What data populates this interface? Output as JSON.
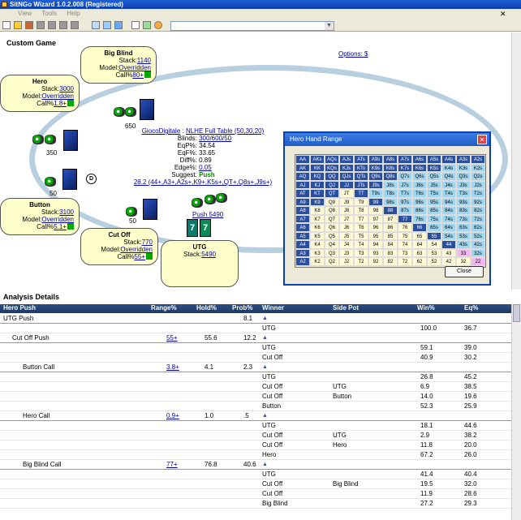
{
  "window": {
    "title": "SitNGo Wizard 1.0.2.008 (Registered)"
  },
  "menu": {
    "items": [
      "View",
      "Tools",
      "Help"
    ]
  },
  "custom_game": {
    "heading": "Custom Game",
    "options_link": "Options: $"
  },
  "players": {
    "big_blind": {
      "name": "Big Blind",
      "stack_label": "Stack:",
      "stack": "1140",
      "model_label": "Model:",
      "model": "Overridden",
      "call_label": "Call%",
      "call": "80+"
    },
    "hero": {
      "name": "Hero",
      "stack_label": "Stack:",
      "stack": "3000",
      "model_label": "Model:",
      "model": "Overridden",
      "call_label": "Call%",
      "call": "1.8+"
    },
    "button": {
      "name": "Button",
      "stack_label": "Stack:",
      "stack": "3100",
      "model_label": "Model:",
      "model": "Overridden",
      "call_label": "Call%",
      "call": "5.1+"
    },
    "cut_off": {
      "name": "Cut Off",
      "stack_label": "Stack:",
      "stack": "770",
      "model_label": "Model:",
      "model": "Overridden",
      "call_label": "Call%",
      "call": "55+"
    },
    "utg": {
      "name": "UTG",
      "stack_label": "Stack:",
      "stack": "5490"
    }
  },
  "bets": {
    "bb_chips": "650",
    "hero_chips": "350",
    "button_chips": "50",
    "cut_off_chips": "50",
    "utg_push": "Push 5490"
  },
  "dealer": "D",
  "hero_cards": [
    "7",
    "7"
  ],
  "info": {
    "site": "GiocoDigitale",
    "table": "NLHE Full Table (50,30,20)",
    "rows": [
      {
        "k": "Blinds:",
        "v": "300/600/50",
        "link": true
      },
      {
        "k": "EqP%:",
        "v": "34.54",
        "link": false
      },
      {
        "k": "EqF%:",
        "v": "33.65",
        "link": false
      },
      {
        "k": "Diff%:",
        "v": "0.89",
        "link": false
      },
      {
        "k": "Edge%:",
        "v": "0.05",
        "link": true
      }
    ],
    "suggest_label": "Suggest:",
    "suggest_value": "Push",
    "range": "28.2 (44+,A3+,A2s+,K9+,K5s+,QT+,Q8s+,J9s+)"
  },
  "dialog": {
    "title": "Hero Hand Range",
    "close_label": "Close",
    "grid": [
      [
        "AA",
        "AKs",
        "AQs",
        "AJs",
        "ATs",
        "A9s",
        "A8s",
        "A7s",
        "A6s",
        "A5s",
        "A4s",
        "A3s",
        "A2s"
      ],
      [
        "AK",
        "KK",
        "KQs",
        "KJs",
        "KTs",
        "K9s",
        "K8s",
        "K7s",
        "K6s",
        "K5s",
        "K4s",
        "K3s",
        "K2s"
      ],
      [
        "AQ",
        "KQ",
        "QQ",
        "QJs",
        "QTs",
        "Q9s",
        "Q8s",
        "Q7s",
        "Q6s",
        "Q5s",
        "Q4s",
        "Q3s",
        "Q2s"
      ],
      [
        "AJ",
        "KJ",
        "QJ",
        "JJ",
        "JTs",
        "J9s",
        "J8s",
        "J7s",
        "J6s",
        "J5s",
        "J4s",
        "J3s",
        "J2s"
      ],
      [
        "AT",
        "KT",
        "QT",
        "JT",
        "TT",
        "T9s",
        "T8s",
        "T7s",
        "T6s",
        "T5s",
        "T4s",
        "T3s",
        "T2s"
      ],
      [
        "A9",
        "K9",
        "Q9",
        "J9",
        "T9",
        "99",
        "98s",
        "97s",
        "96s",
        "95s",
        "94s",
        "93s",
        "92s"
      ],
      [
        "A8",
        "K8",
        "Q8",
        "J8",
        "T8",
        "98",
        "88",
        "87s",
        "86s",
        "85s",
        "84s",
        "83s",
        "82s"
      ],
      [
        "A7",
        "K7",
        "Q7",
        "J7",
        "T7",
        "97",
        "87",
        "77",
        "76s",
        "75s",
        "74s",
        "73s",
        "72s"
      ],
      [
        "A6",
        "K6",
        "Q6",
        "J6",
        "T6",
        "96",
        "86",
        "76",
        "66",
        "65s",
        "64s",
        "63s",
        "62s"
      ],
      [
        "A5",
        "K5",
        "Q5",
        "J5",
        "T5",
        "95",
        "85",
        "75",
        "65",
        "55",
        "54s",
        "53s",
        "52s"
      ],
      [
        "A4",
        "K4",
        "Q4",
        "J4",
        "T4",
        "94",
        "84",
        "74",
        "64",
        "54",
        "44",
        "43s",
        "42s"
      ],
      [
        "A3",
        "K3",
        "Q3",
        "J3",
        "T3",
        "93",
        "83",
        "73",
        "63",
        "53",
        "43",
        "33",
        "32s"
      ],
      [
        "A2",
        "K2",
        "Q2",
        "J2",
        "T2",
        "92",
        "82",
        "72",
        "62",
        "52",
        "42",
        "32",
        "22"
      ]
    ],
    "classes": [
      [
        "s",
        "s",
        "s",
        "s",
        "s",
        "s",
        "s",
        "s",
        "s",
        "s",
        "s",
        "s",
        "s"
      ],
      [
        "s",
        "s",
        "s",
        "s",
        "s",
        "s",
        "s",
        "s",
        "s",
        "s",
        "l",
        "l",
        "l"
      ],
      [
        "s",
        "s",
        "s",
        "s",
        "s",
        "s",
        "s",
        "l",
        "l",
        "l",
        "l",
        "l",
        "l"
      ],
      [
        "s",
        "s",
        "s",
        "s",
        "s",
        "s",
        "l",
        "l",
        "l",
        "l",
        "l",
        "l",
        "l"
      ],
      [
        "s",
        "s",
        "s",
        "n",
        "s",
        "l",
        "l",
        "l",
        "l",
        "l",
        "l",
        "l",
        "l"
      ],
      [
        "s",
        "s",
        "n",
        "n",
        "n",
        "s",
        "l",
        "l",
        "l",
        "l",
        "l",
        "l",
        "l"
      ],
      [
        "s",
        "n",
        "n",
        "n",
        "n",
        "n",
        "s",
        "l",
        "l",
        "l",
        "l",
        "l",
        "l"
      ],
      [
        "s",
        "n",
        "n",
        "n",
        "n",
        "n",
        "n",
        "s",
        "l",
        "l",
        "l",
        "l",
        "l"
      ],
      [
        "s",
        "n",
        "n",
        "n",
        "n",
        "n",
        "n",
        "n",
        "s",
        "l",
        "l",
        "l",
        "l"
      ],
      [
        "s",
        "n",
        "n",
        "n",
        "n",
        "n",
        "n",
        "n",
        "n",
        "s",
        "l",
        "l",
        "l"
      ],
      [
        "s",
        "n",
        "n",
        "n",
        "n",
        "n",
        "n",
        "n",
        "n",
        "n",
        "s",
        "l",
        "l"
      ],
      [
        "s",
        "n",
        "n",
        "n",
        "n",
        "n",
        "n",
        "n",
        "n",
        "n",
        "n",
        "p",
        "l"
      ],
      [
        "s",
        "n",
        "n",
        "n",
        "n",
        "n",
        "n",
        "n",
        "n",
        "n",
        "n",
        "n",
        "p"
      ]
    ]
  },
  "analysis": {
    "heading": "Analysis Details",
    "columns": {
      "hero_push": "Hero Push",
      "range": "Range%",
      "hold": "Hold%",
      "prob": "Prob%",
      "winner": "Winner",
      "side_pot": "Side Pot",
      "win": "Win%",
      "eq": "Eq%"
    },
    "rows": [
      {
        "name": "UTG Push",
        "indent": 0,
        "range": "",
        "hold": "",
        "prob": "8.1",
        "winner": "",
        "side": "",
        "win": "",
        "eq": "",
        "tri": true,
        "top": true
      },
      {
        "name": "",
        "indent": 0,
        "range": "",
        "hold": "",
        "prob": "",
        "winner": "UTG",
        "side": "",
        "win": "100.0",
        "eq": "36.7",
        "tri": false,
        "top": false
      },
      {
        "name": "Cut Off Push",
        "indent": 1,
        "range": "55+",
        "hold": "55.6",
        "prob": "12.2",
        "winner": "",
        "side": "",
        "win": "",
        "eq": "",
        "tri": true,
        "top": true
      },
      {
        "name": "",
        "indent": 0,
        "range": "",
        "hold": "",
        "prob": "",
        "winner": "UTG",
        "side": "",
        "win": "59.1",
        "eq": "39.0",
        "tri": false,
        "top": false
      },
      {
        "name": "",
        "indent": 0,
        "range": "",
        "hold": "",
        "prob": "",
        "winner": "Cut Off",
        "side": "",
        "win": "40.9",
        "eq": "30.2",
        "tri": false,
        "top": false
      },
      {
        "name": "Button Call",
        "indent": 2,
        "range": "3.8+",
        "hold": "4.1",
        "prob": "2.3",
        "winner": "",
        "side": "",
        "win": "",
        "eq": "",
        "tri": true,
        "top": true
      },
      {
        "name": "",
        "indent": 0,
        "range": "",
        "hold": "",
        "prob": "",
        "winner": "UTG",
        "side": "",
        "win": "26.8",
        "eq": "45.2",
        "tri": false,
        "top": false
      },
      {
        "name": "",
        "indent": 0,
        "range": "",
        "hold": "",
        "prob": "",
        "winner": "Cut Off",
        "side": "UTG",
        "win": "6.9",
        "eq": "38.5",
        "tri": false,
        "top": false
      },
      {
        "name": "",
        "indent": 0,
        "range": "",
        "hold": "",
        "prob": "",
        "winner": "Cut Off",
        "side": "Button",
        "win": "14.0",
        "eq": "19.6",
        "tri": false,
        "top": false
      },
      {
        "name": "",
        "indent": 0,
        "range": "",
        "hold": "",
        "prob": "",
        "winner": "Button",
        "side": "",
        "win": "52.3",
        "eq": "25.9",
        "tri": false,
        "top": false
      },
      {
        "name": "Hero Call",
        "indent": 2,
        "range": "0.9+",
        "hold": "1.0",
        "prob": ".5",
        "winner": "",
        "side": "",
        "win": "",
        "eq": "",
        "tri": true,
        "top": true
      },
      {
        "name": "",
        "indent": 0,
        "range": "",
        "hold": "",
        "prob": "",
        "winner": "UTG",
        "side": "",
        "win": "18.1",
        "eq": "44.6",
        "tri": false,
        "top": false
      },
      {
        "name": "",
        "indent": 0,
        "range": "",
        "hold": "",
        "prob": "",
        "winner": "Cut Off",
        "side": "UTG",
        "win": "2.9",
        "eq": "38.2",
        "tri": false,
        "top": false
      },
      {
        "name": "",
        "indent": 0,
        "range": "",
        "hold": "",
        "prob": "",
        "winner": "Cut Off",
        "side": "Hero",
        "win": "11.8",
        "eq": "20.0",
        "tri": false,
        "top": false
      },
      {
        "name": "",
        "indent": 0,
        "range": "",
        "hold": "",
        "prob": "",
        "winner": "Hero",
        "side": "",
        "win": "67.2",
        "eq": "26.0",
        "tri": false,
        "top": false
      },
      {
        "name": "Big Blind Call",
        "indent": 2,
        "range": "77+",
        "hold": "76.8",
        "prob": "40.6",
        "winner": "",
        "side": "",
        "win": "",
        "eq": "",
        "tri": true,
        "top": true
      },
      {
        "name": "",
        "indent": 0,
        "range": "",
        "hold": "",
        "prob": "",
        "winner": "UTG",
        "side": "",
        "win": "41.4",
        "eq": "40.4",
        "tri": false,
        "top": false
      },
      {
        "name": "",
        "indent": 0,
        "range": "",
        "hold": "",
        "prob": "",
        "winner": "Cut Off",
        "side": "Big Blind",
        "win": "19.5",
        "eq": "32.0",
        "tri": false,
        "top": false
      },
      {
        "name": "",
        "indent": 0,
        "range": "",
        "hold": "",
        "prob": "",
        "winner": "Cut Off",
        "side": "",
        "win": "11.9",
        "eq": "28.6",
        "tri": false,
        "top": false
      },
      {
        "name": "",
        "indent": 0,
        "range": "",
        "hold": "",
        "prob": "",
        "winner": "Big Blind",
        "side": "",
        "win": "27.2",
        "eq": "29.3",
        "tri": false,
        "top": false
      }
    ]
  }
}
